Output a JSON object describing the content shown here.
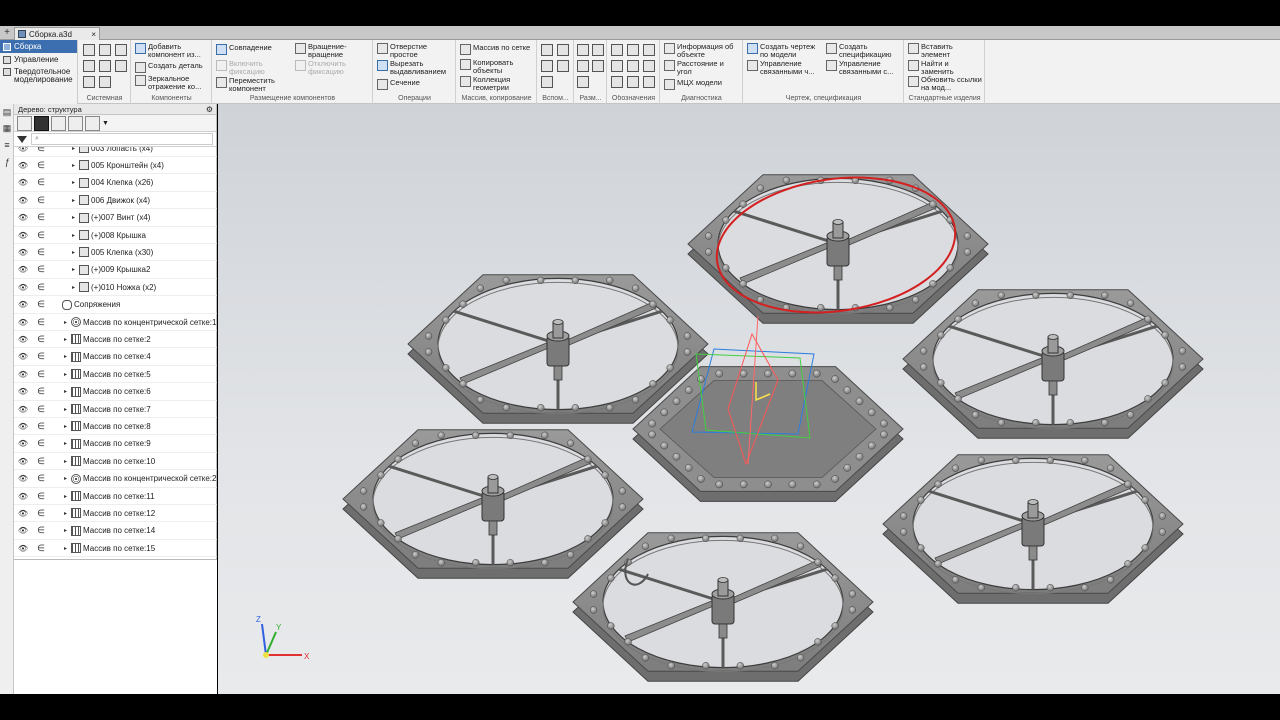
{
  "document": {
    "tab_title": "Сборка.a3d",
    "close": "×",
    "plus": "+"
  },
  "modes": [
    {
      "label": "Сборка",
      "active": true
    },
    {
      "label": "Управление",
      "active": false
    },
    {
      "label": "Твердотельное моделирование",
      "active": false
    }
  ],
  "ribbon": {
    "groups": [
      {
        "label": "Системная"
      },
      {
        "label": "Компоненты",
        "commands": [
          "Добавить компонент из...",
          "Создать деталь",
          "Зеркальное отражение ко..."
        ]
      },
      {
        "label": "Размещение компонентов",
        "commands": [
          "Совпадение",
          "Вращение-вращение",
          "Включить фиксацию",
          "Отключить фиксацию",
          "Переместить компонент"
        ]
      },
      {
        "label": "Операции",
        "commands": [
          "Отверстие простое",
          "Вырезать выдавливанием",
          "Сечение"
        ]
      },
      {
        "label": "Массив, копирование",
        "commands": [
          "Массив по сетке",
          "Копировать объекты",
          "Коллекция геометрии"
        ]
      },
      {
        "label": "Вспом..."
      },
      {
        "label": "Разм..."
      },
      {
        "label": "Обозначения"
      },
      {
        "label": "Диагностика",
        "commands": [
          "Информация об объекте",
          "Расстояние и угол",
          "МЦХ модели"
        ]
      },
      {
        "label": "Чертеж, спецификация",
        "commands": [
          "Создать чертеж по модели",
          "Управление связанными ч...",
          "Создать спецификацию",
          "Управление связанными с..."
        ]
      },
      {
        "label": "Стандартные изделия",
        "commands": [
          "Вставить элемент",
          "Найти и заменить",
          "Обновить ссылки на мод..."
        ]
      }
    ]
  },
  "tree": {
    "header": "Дерево: структура",
    "filter_placeholder": "⌕",
    "rows": [
      {
        "label": "003 Лопасть (x4)",
        "indent": 3
      },
      {
        "label": "005 Кронштейн  (x4)",
        "indent": 3
      },
      {
        "label": "004 Клепка  (x26)",
        "indent": 3
      },
      {
        "label": "006 Движок  (x4)",
        "indent": 3
      },
      {
        "label": "(+)007 Винт  (x4)",
        "indent": 3
      },
      {
        "label": "(+)008 Крышка",
        "indent": 3
      },
      {
        "label": "005 Клепка  (x30)",
        "indent": 3
      },
      {
        "label": "(+)009 Крышка2",
        "indent": 3
      },
      {
        "label": "(+)010 Ножка  (x2)",
        "indent": 3
      },
      {
        "label": "Сопряжения",
        "indent": 2
      },
      {
        "label": "Массив по концентрической сетке:1",
        "indent": 2
      },
      {
        "label": "Массив по сетке:2",
        "indent": 2
      },
      {
        "label": "Массив по сетке:4",
        "indent": 2
      },
      {
        "label": "Массив по сетке:5",
        "indent": 2
      },
      {
        "label": "Массив по сетке:6",
        "indent": 2
      },
      {
        "label": "Массив по сетке:7",
        "indent": 2
      },
      {
        "label": "Массив по сетке:8",
        "indent": 2
      },
      {
        "label": "Массив по сетке:9",
        "indent": 2
      },
      {
        "label": "Массив по сетке:10",
        "indent": 2
      },
      {
        "label": "Массив по концентрической сетке:2",
        "indent": 2
      },
      {
        "label": "Массив по сетке:11",
        "indent": 2
      },
      {
        "label": "Массив по сетке:12",
        "indent": 2
      },
      {
        "label": "Массив по сетке:14",
        "indent": 2
      },
      {
        "label": "Массив по сетке:15",
        "indent": 2
      }
    ]
  },
  "triad": {
    "x": "X",
    "y": "Y",
    "z": "Z"
  },
  "colors": {
    "accent": "#3c6fb0",
    "highlight": "#d42020",
    "model": "#8a8a8a"
  }
}
